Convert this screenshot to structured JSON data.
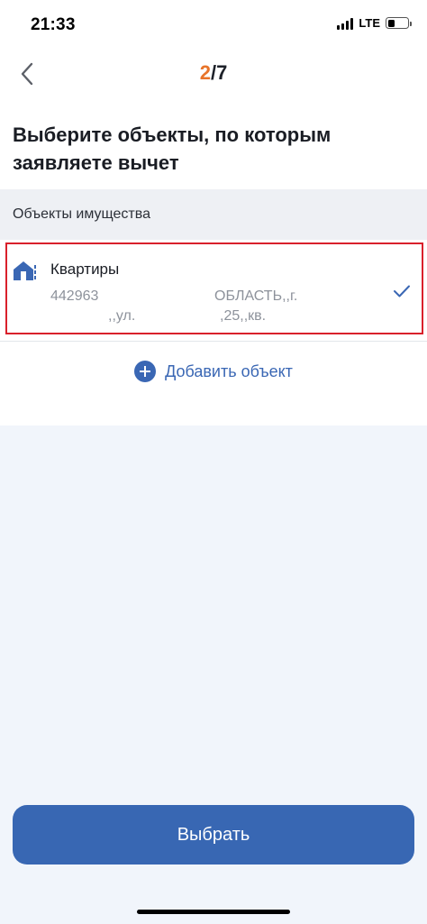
{
  "status_bar": {
    "time": "21:33",
    "network": "LTE"
  },
  "nav": {
    "step_current": "2",
    "step_separator": "/",
    "step_total": "7"
  },
  "page_title": "Выберите объекты, по которым заявляете вычет",
  "section": {
    "label": "Объекты имущества"
  },
  "property": {
    "title": "Квартиры",
    "address_line1_left": "442963",
    "address_line1_right": "ОБЛАСТЬ,,г.",
    "address_line2_left": ",,ул.",
    "address_line2_right": ",25,,кв.",
    "selected": true
  },
  "add_object": {
    "label": "Добавить объект"
  },
  "select_button": {
    "label": "Выбрать"
  },
  "colors": {
    "accent": "#3867b3",
    "step_highlight": "#e8742a",
    "selection_border": "#d9202b"
  }
}
